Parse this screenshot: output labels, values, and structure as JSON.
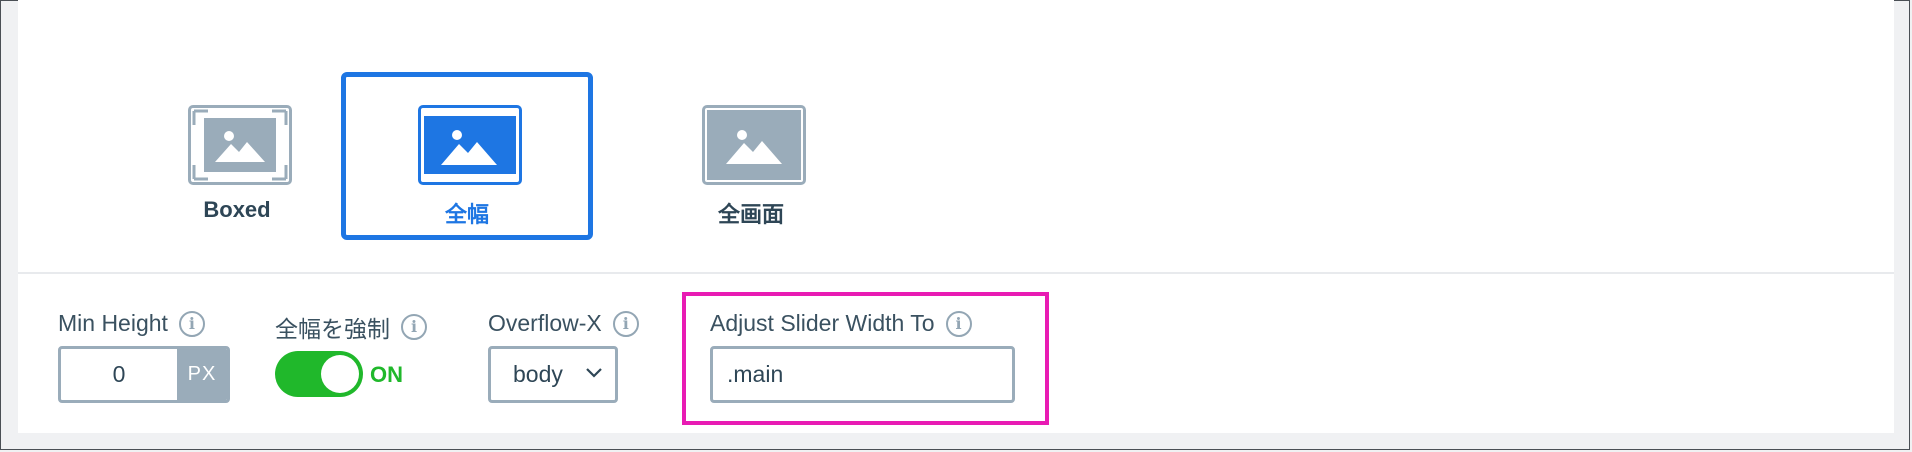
{
  "layouts": [
    {
      "label": "Boxed",
      "icon": "image-boxed-icon",
      "selected": false
    },
    {
      "label": "全幅",
      "icon": "image-fullwidth-icon",
      "selected": true
    },
    {
      "label": "全画面",
      "icon": "image-fullscreen-icon",
      "selected": false
    }
  ],
  "controls": {
    "min_height": {
      "label": "Min Height",
      "value": "0",
      "unit": "PX"
    },
    "force_fullwidth": {
      "label": "全幅を強制",
      "state": "ON"
    },
    "overflow_x": {
      "label": "Overflow-X",
      "value": "body"
    },
    "adjust_slider": {
      "label": "Adjust Slider Width To",
      "value": ".main"
    }
  },
  "colors": {
    "accent": "#1e76e3",
    "toggle_on": "#20b82b",
    "highlight": "#e81bb3",
    "muted": "#9aacba"
  }
}
